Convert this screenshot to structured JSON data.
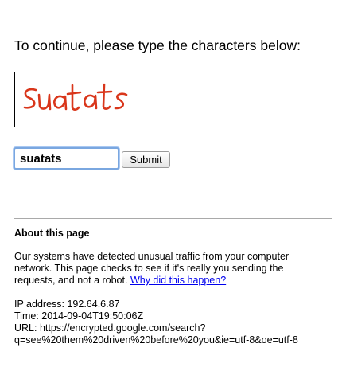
{
  "page": {
    "prompt": "To continue, please type the characters below:",
    "captcha": {
      "text": "suatats",
      "color": "#d9361b"
    },
    "answer_input": {
      "value": "suatats",
      "focus_color": "#7aa7e0"
    },
    "submit_label": "Submit"
  },
  "about": {
    "heading": "About this page",
    "lines": [
      "Our systems have detected unusual traffic from your computer",
      "network. This page checks to see if it's really you sending the",
      "requests, and not a robot. "
    ],
    "why_link": "Why did this happen?",
    "link_color": "#0000ee",
    "ip_line": "IP address: 192.64.6.87",
    "time_line": "Time: 2014-09-04T19:50:06Z",
    "url_line": "URL: https://encrypted.google.com/search?",
    "query_line": "q=see%20them%20driven%20before%20you&ie=utf-8&oe=utf-8"
  }
}
